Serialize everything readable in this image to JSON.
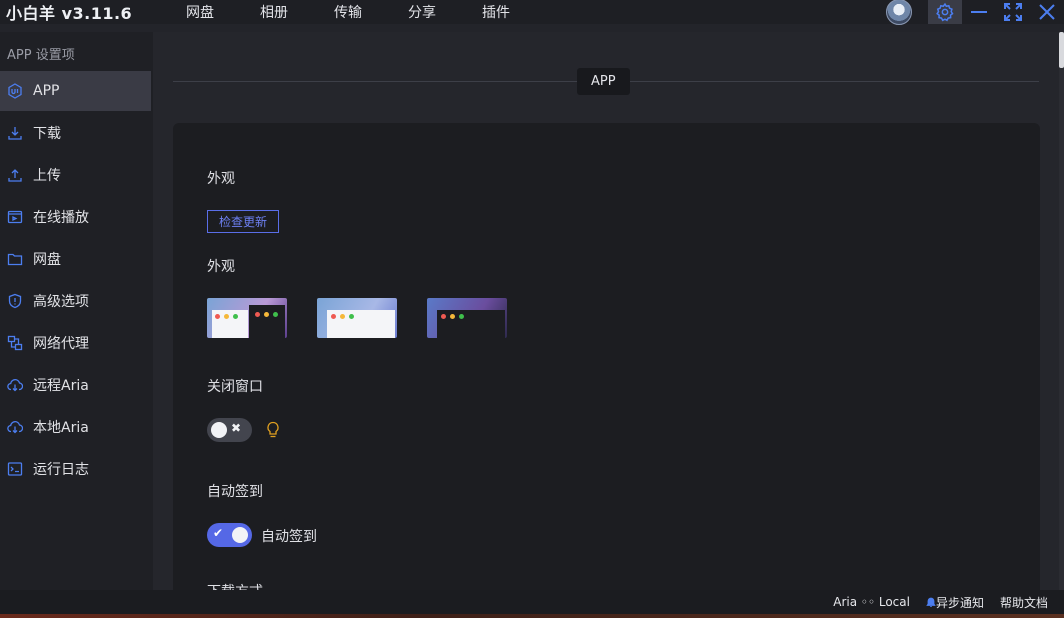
{
  "app": {
    "title": "小白羊 v3.11.6"
  },
  "top_nav": [
    "网盘",
    "相册",
    "传输",
    "分享",
    "插件"
  ],
  "sidebar": {
    "heading": "APP 设置项",
    "items": [
      {
        "label": "APP",
        "icon": "app-ui-icon",
        "active": true
      },
      {
        "label": "下载",
        "icon": "download-icon"
      },
      {
        "label": "上传",
        "icon": "upload-icon"
      },
      {
        "label": "在线播放",
        "icon": "player-icon"
      },
      {
        "label": "网盘",
        "icon": "folder-icon"
      },
      {
        "label": "高级选项",
        "icon": "shield-icon"
      },
      {
        "label": "网络代理",
        "icon": "proxy-icon"
      },
      {
        "label": "远程Aria",
        "icon": "cloud-download-icon"
      },
      {
        "label": "本地Aria",
        "icon": "cloud-download-icon"
      },
      {
        "label": "运行日志",
        "icon": "log-icon"
      }
    ]
  },
  "main": {
    "section_title": "APP",
    "appearance_label": "外观",
    "check_update_button": "检查更新",
    "theme_label": "外观",
    "close_window_label": "关闭窗口",
    "auto_sign_label": "自动签到",
    "auto_sign_switch_text": "自动签到",
    "cut_off_label": "下载方式"
  },
  "statusbar": {
    "aria": "Aria ◦◦ Local",
    "async_notice": "异步通知",
    "help": "帮助文档"
  },
  "colors": {
    "accent": "#5568e6",
    "bulb": "#e0a020"
  }
}
